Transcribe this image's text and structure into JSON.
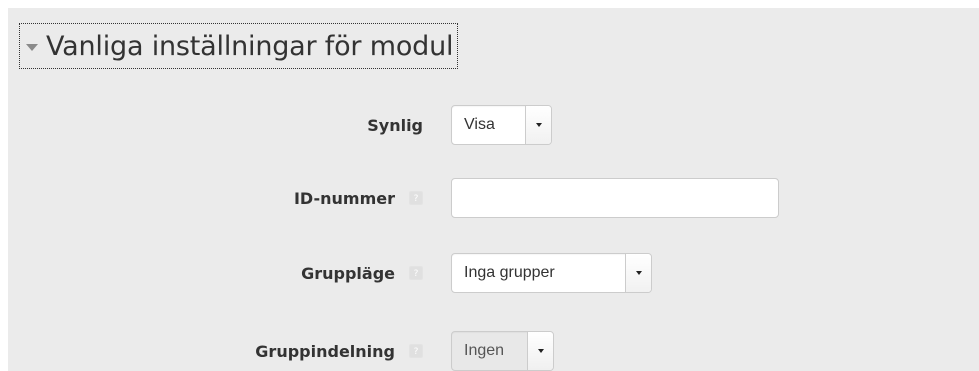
{
  "section": {
    "title": "Vanliga inställningar för modul"
  },
  "fields": {
    "visible": {
      "label": "Synlig",
      "value": "Visa"
    },
    "idnumber": {
      "label": "ID-nummer",
      "value": "",
      "help_icon": "help-icon"
    },
    "groupmode": {
      "label": "Gruppläge",
      "value": "Inga grupper",
      "help_icon": "help-icon"
    },
    "grouping": {
      "label": "Gruppindelning",
      "value": "Ingen",
      "help_icon": "help-icon",
      "disabled": true
    }
  },
  "colors": {
    "background": "#ebebeb",
    "text": "#333333",
    "border": "#cccccc"
  }
}
